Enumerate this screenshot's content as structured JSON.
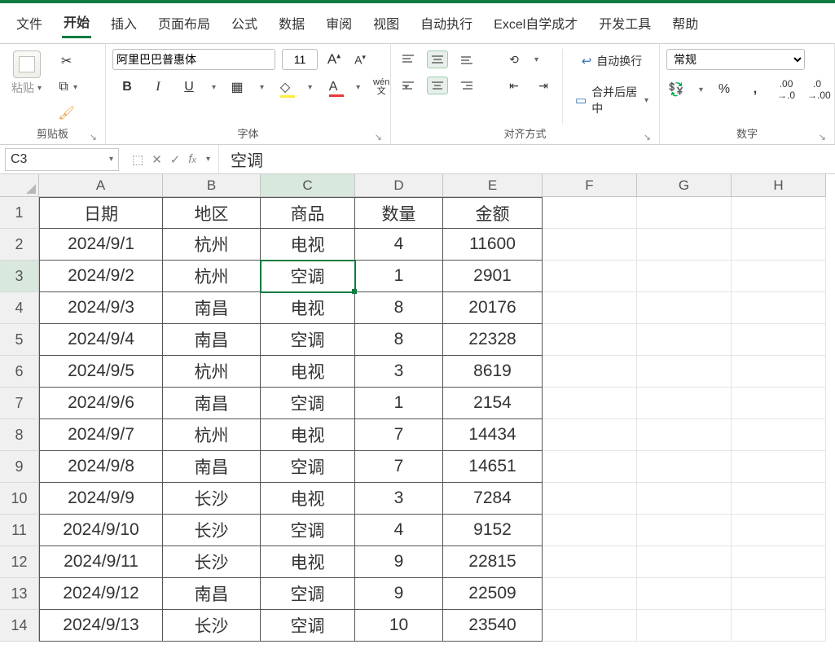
{
  "tabs": [
    "文件",
    "开始",
    "插入",
    "页面布局",
    "公式",
    "数据",
    "审阅",
    "视图",
    "自动执行",
    "Excel自学成才",
    "开发工具",
    "帮助"
  ],
  "active_tab_index": 1,
  "ribbon": {
    "clipboard": {
      "paste": "粘贴",
      "group": "剪贴板"
    },
    "font": {
      "name": "阿里巴巴普惠体",
      "size": "11",
      "group": "字体",
      "bold": "B",
      "italic": "I",
      "underline": "U",
      "wen": "wén",
      "wen2": "文"
    },
    "align": {
      "wrap": "自动换行",
      "merge": "合并后居中",
      "group": "对齐方式"
    },
    "number": {
      "format": "常规",
      "group": "数字"
    }
  },
  "formula": {
    "cell_ref": "C3",
    "value": "空调"
  },
  "columns": [
    "A",
    "B",
    "C",
    "D",
    "E",
    "F",
    "G",
    "H"
  ],
  "headers": [
    "日期",
    "地区",
    "商品",
    "数量",
    "金额"
  ],
  "rows": [
    {
      "r": 1
    },
    {
      "r": 2,
      "d": [
        "2024/9/1",
        "杭州",
        "电视",
        "4",
        "11600"
      ]
    },
    {
      "r": 3,
      "d": [
        "2024/9/2",
        "杭州",
        "空调",
        "1",
        "2901"
      ]
    },
    {
      "r": 4,
      "d": [
        "2024/9/3",
        "南昌",
        "电视",
        "8",
        "20176"
      ]
    },
    {
      "r": 5,
      "d": [
        "2024/9/4",
        "南昌",
        "空调",
        "8",
        "22328"
      ]
    },
    {
      "r": 6,
      "d": [
        "2024/9/5",
        "杭州",
        "电视",
        "3",
        "8619"
      ]
    },
    {
      "r": 7,
      "d": [
        "2024/9/6",
        "南昌",
        "空调",
        "1",
        "2154"
      ]
    },
    {
      "r": 8,
      "d": [
        "2024/9/7",
        "杭州",
        "电视",
        "7",
        "14434"
      ]
    },
    {
      "r": 9,
      "d": [
        "2024/9/8",
        "南昌",
        "空调",
        "7",
        "14651"
      ]
    },
    {
      "r": 10,
      "d": [
        "2024/9/9",
        "长沙",
        "电视",
        "3",
        "7284"
      ]
    },
    {
      "r": 11,
      "d": [
        "2024/9/10",
        "长沙",
        "空调",
        "4",
        "9152"
      ]
    },
    {
      "r": 12,
      "d": [
        "2024/9/11",
        "长沙",
        "电视",
        "9",
        "22815"
      ]
    },
    {
      "r": 13,
      "d": [
        "2024/9/12",
        "南昌",
        "空调",
        "9",
        "22509"
      ]
    },
    {
      "r": 14,
      "d": [
        "2024/9/13",
        "长沙",
        "空调",
        "10",
        "23540"
      ]
    }
  ],
  "selected": {
    "row": 3,
    "col": 2
  }
}
